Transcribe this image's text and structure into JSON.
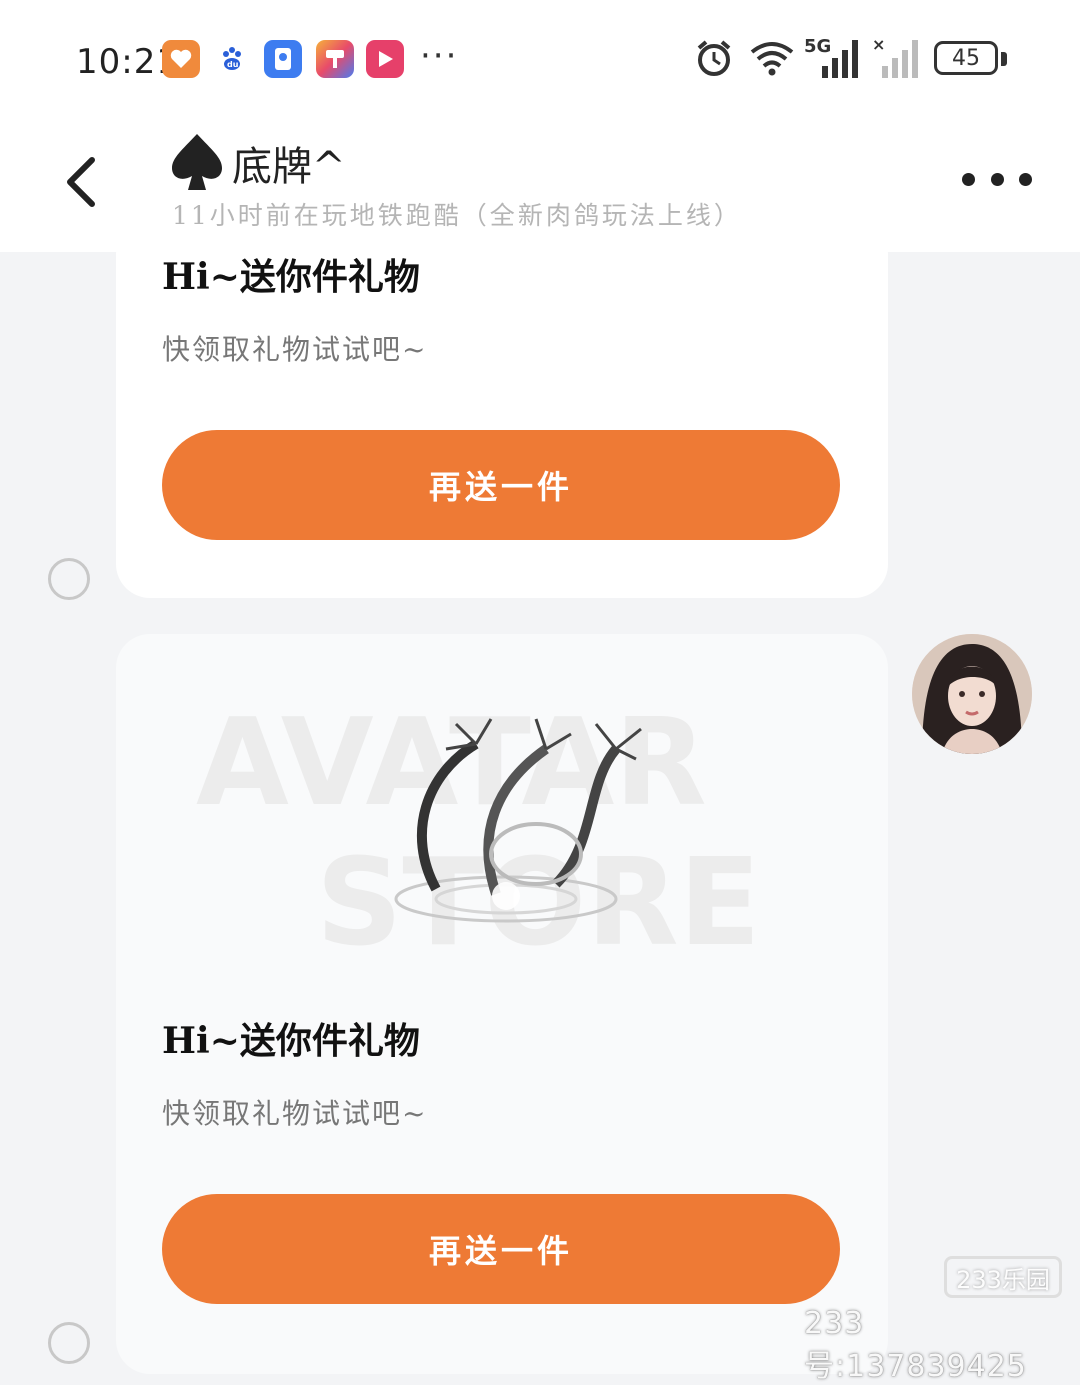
{
  "status_bar": {
    "time": "10:21",
    "apps": [
      {
        "icon": "heart-app-icon",
        "color": "#f08a3c"
      },
      {
        "icon": "baidu-paw-icon",
        "color": "#2a7fff"
      },
      {
        "icon": "idea-app-icon",
        "color": "#3d7cf0"
      },
      {
        "icon": "paint-app-icon",
        "color": "#f6b13b"
      },
      {
        "icon": "video-play-icon",
        "color": "#e6406a"
      }
    ],
    "more": "···",
    "network": "5G",
    "battery": "45"
  },
  "header": {
    "title": "底牌^",
    "subtitle": "11小时前在玩地铁跑酷（全新肉鸽玩法上线）",
    "back_icon": "chevron-left-icon",
    "more_icon": "more-dots-icon"
  },
  "messages": [
    {
      "title": "Hi~送你件礼物",
      "subtitle": "快领取礼物试试吧~",
      "button": "再送一件"
    },
    {
      "image_watermark": "AVATAR STORE",
      "title": "Hi~送你件礼物",
      "subtitle": "快领取礼物试试吧~",
      "button": "再送一件"
    }
  ],
  "watermark": {
    "badge": "233乐园",
    "text": "233号:137839425"
  },
  "colors": {
    "accent": "#ee7a35",
    "background": "#f3f4f6",
    "card": "#ffffff"
  }
}
